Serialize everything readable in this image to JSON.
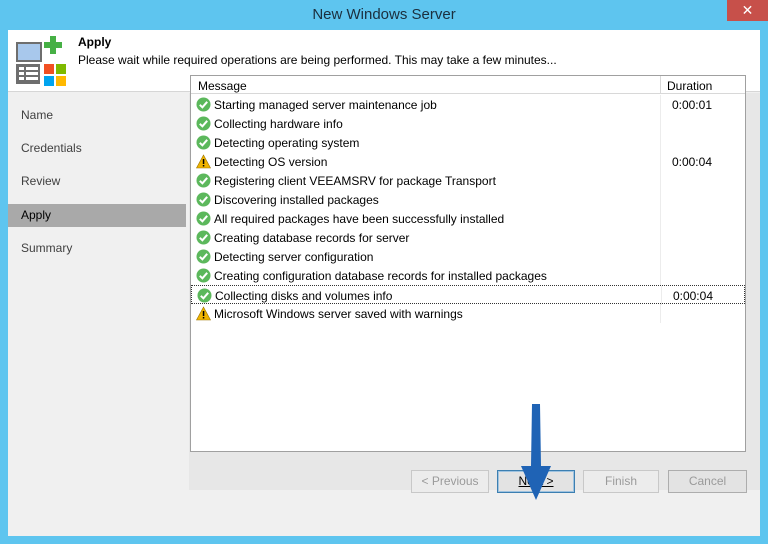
{
  "window": {
    "title": "New Windows Server",
    "close_glyph": "✕"
  },
  "header": {
    "title": "Apply",
    "description": "Please wait while required operations are being performed. This may take a few minutes...",
    "icon": "server-add-icon"
  },
  "nav": {
    "items": [
      {
        "label": "Name",
        "active": false
      },
      {
        "label": "Credentials",
        "active": false
      },
      {
        "label": "Review",
        "active": false
      },
      {
        "label": "Apply",
        "active": true
      },
      {
        "label": "Summary",
        "active": false
      }
    ]
  },
  "grid": {
    "columns": {
      "message": "Message",
      "duration": "Duration"
    },
    "rows": [
      {
        "status": "success",
        "message": "Starting managed server maintenance job",
        "duration": "0:00:01"
      },
      {
        "status": "success",
        "message": "Collecting hardware info",
        "duration": ""
      },
      {
        "status": "success",
        "message": "Detecting operating system",
        "duration": ""
      },
      {
        "status": "warning",
        "message": "Detecting OS version",
        "duration": "0:00:04"
      },
      {
        "status": "success",
        "message": "Registering client VEEAMSRV for package Transport",
        "duration": ""
      },
      {
        "status": "success",
        "message": "Discovering installed packages",
        "duration": ""
      },
      {
        "status": "success",
        "message": "All required packages have been successfully installed",
        "duration": ""
      },
      {
        "status": "success",
        "message": "Creating database records for server",
        "duration": ""
      },
      {
        "status": "success",
        "message": "Detecting server configuration",
        "duration": ""
      },
      {
        "status": "success",
        "message": "Creating configuration database records for installed packages",
        "duration": ""
      },
      {
        "status": "success",
        "message": "Collecting disks and volumes info",
        "duration": "0:00:04",
        "selected": true
      },
      {
        "status": "warning",
        "message": "Microsoft Windows server saved with warnings",
        "duration": ""
      }
    ]
  },
  "buttons": {
    "previous": "< Previous",
    "next": "Next >",
    "finish": "Finish",
    "cancel": "Cancel"
  },
  "colors": {
    "success": "#5cb85c",
    "warning": "#f0b400",
    "arrow": "#1f63b5"
  }
}
